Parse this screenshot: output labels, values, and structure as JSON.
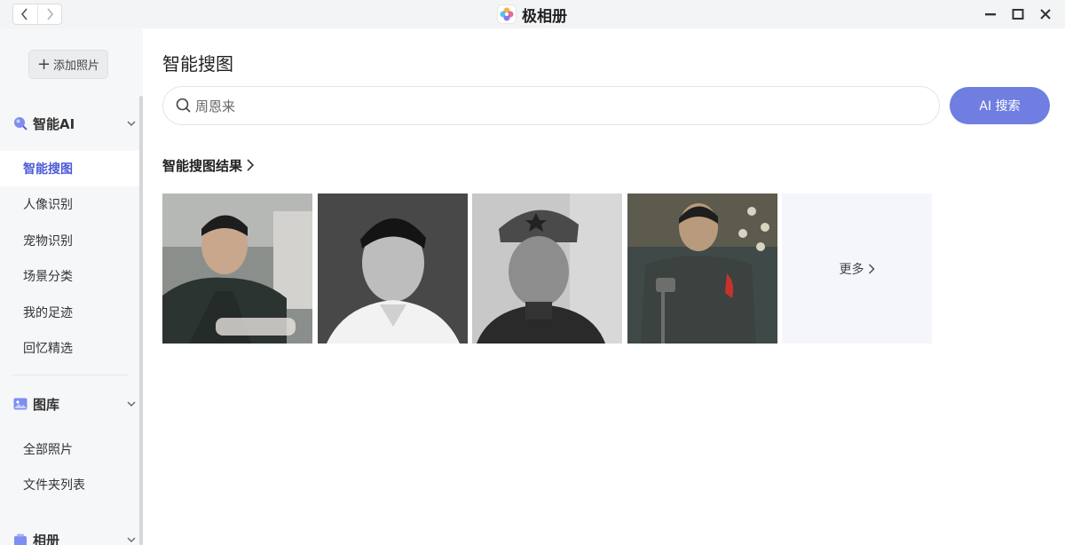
{
  "titlebar": {
    "app_name": "极相册",
    "icons": [
      "back-icon",
      "forward-icon",
      "app-logo-icon",
      "minimize-icon",
      "maximize-icon",
      "close-icon"
    ]
  },
  "sidebar": {
    "add_photo_label": "添加照片",
    "sections": [
      {
        "label": "智能AI",
        "icon": "ai-sparkle-icon",
        "items": [
          "智能搜图",
          "人像识别",
          "宠物识别",
          "场景分类",
          "我的足迹",
          "回忆精选"
        ]
      },
      {
        "label": "图库",
        "icon": "gallery-icon",
        "items": [
          "全部照片",
          "文件夹列表"
        ]
      },
      {
        "label": "相册",
        "icon": "album-icon",
        "items": []
      }
    ],
    "active_item": "智能搜图"
  },
  "main": {
    "title": "智能搜图",
    "search": {
      "value": "周恩来",
      "placeholder": ""
    },
    "ai_search_button": "AI 搜索",
    "results_heading": "智能搜图结果",
    "results_count_shown": 4,
    "more_label": "更多"
  },
  "colors": {
    "accent": "#4a5bd8",
    "button": "#6f7ee0",
    "sidebar_bg": "#f6f7f9",
    "titlebar_bg": "#f3f4f6"
  }
}
